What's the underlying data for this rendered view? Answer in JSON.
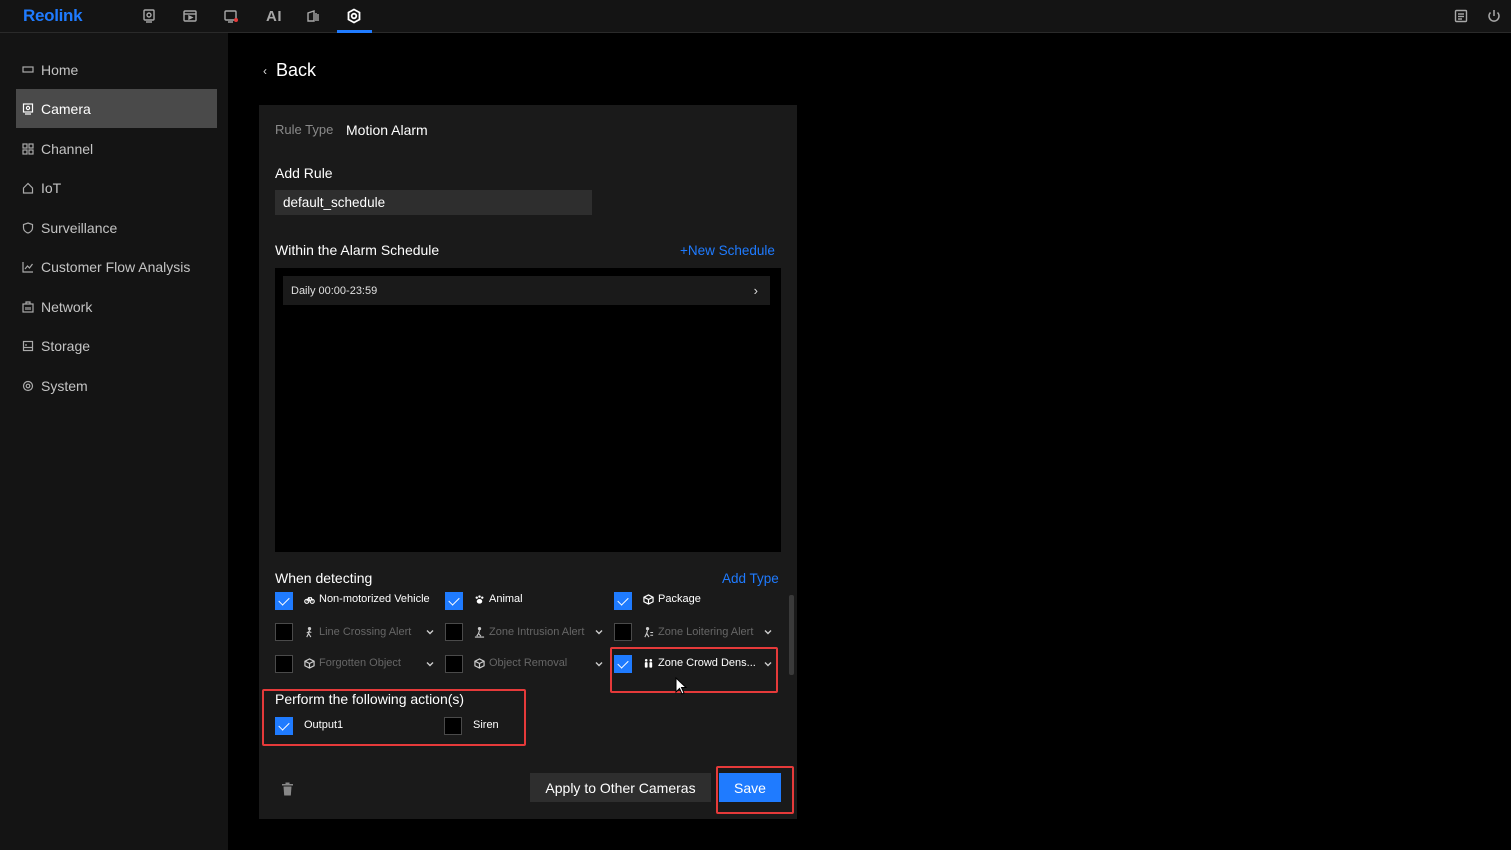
{
  "app": {
    "logo": "Reolink",
    "nav_ai_label": "AI"
  },
  "sidebar": {
    "items": [
      {
        "label": "Home",
        "icon": "monitor-icon",
        "active": false
      },
      {
        "label": "Camera",
        "icon": "camera-icon",
        "active": true
      },
      {
        "label": "Channel",
        "icon": "grid-icon",
        "active": false
      },
      {
        "label": "IoT",
        "icon": "home-icon",
        "active": false
      },
      {
        "label": "Surveillance",
        "icon": "shield-icon",
        "active": false
      },
      {
        "label": "Customer Flow Analysis",
        "icon": "chart-icon",
        "active": false
      },
      {
        "label": "Network",
        "icon": "network-icon",
        "active": false
      },
      {
        "label": "Storage",
        "icon": "storage-icon",
        "active": false
      },
      {
        "label": "System",
        "icon": "gear-icon",
        "active": false
      }
    ]
  },
  "header": {
    "back_label": "Back"
  },
  "rule": {
    "type_label": "Rule Type",
    "type_value": "Motion Alarm",
    "add_rule_label": "Add Rule",
    "rule_name_value": "default_schedule"
  },
  "schedule": {
    "title": "Within the Alarm Schedule",
    "new_link": "+New Schedule",
    "entries": [
      "Daily 00:00-23:59"
    ]
  },
  "detecting": {
    "title": "When detecting",
    "add_link": "Add Type",
    "items": [
      {
        "label": "Non-motorized Vehicle",
        "checked": true,
        "enabled": true,
        "dropdown": false,
        "icon": "bicycle-icon"
      },
      {
        "label": "Animal",
        "checked": true,
        "enabled": true,
        "dropdown": false,
        "icon": "paw-icon"
      },
      {
        "label": "Package",
        "checked": true,
        "enabled": true,
        "dropdown": false,
        "icon": "package-icon"
      },
      {
        "label": "Line Crossing Alert",
        "checked": false,
        "enabled": false,
        "dropdown": true,
        "icon": "walking-person-icon"
      },
      {
        "label": "Zone Intrusion Alert",
        "checked": false,
        "enabled": false,
        "dropdown": true,
        "icon": "intrusion-icon"
      },
      {
        "label": "Zone Loitering Alert",
        "checked": false,
        "enabled": false,
        "dropdown": true,
        "icon": "loitering-icon"
      },
      {
        "label": "Forgotten Object",
        "checked": false,
        "enabled": false,
        "dropdown": true,
        "icon": "box-icon"
      },
      {
        "label": "Object Removal",
        "checked": false,
        "enabled": false,
        "dropdown": true,
        "icon": "box-icon"
      },
      {
        "label": "Zone Crowd Dens...",
        "checked": true,
        "enabled": true,
        "dropdown": true,
        "icon": "crowd-icon"
      }
    ]
  },
  "actions": {
    "title": "Perform the following action(s)",
    "items": [
      {
        "label": "Output1",
        "checked": true
      },
      {
        "label": "Siren",
        "checked": false
      }
    ]
  },
  "footer": {
    "apply_label": "Apply to Other Cameras",
    "save_label": "Save"
  },
  "colors": {
    "accent": "#1f7bff",
    "highlight": "#e53a3a",
    "panel": "#1a1a1a"
  }
}
